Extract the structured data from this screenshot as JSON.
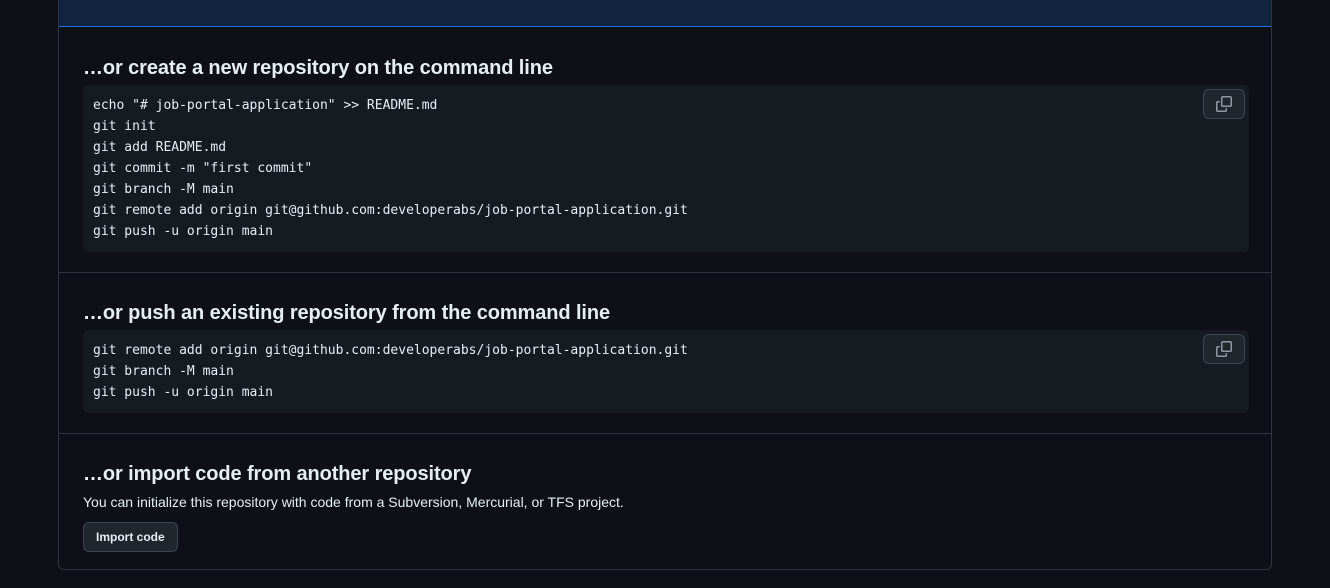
{
  "sections": {
    "create": {
      "title": "…or create a new repository on the command line",
      "lines": [
        "echo \"# job-portal-application\" >> README.md",
        "git init",
        "git add README.md",
        "git commit -m \"first commit\"",
        "git branch -M main",
        "git remote add origin git@github.com:developerabs/job-portal-application.git",
        "git push -u origin main"
      ],
      "copy_icon": "copy-icon"
    },
    "push": {
      "title": "…or push an existing repository from the command line",
      "lines": [
        "git remote add origin git@github.com:developerabs/job-portal-application.git",
        "git branch -M main",
        "git push -u origin main"
      ],
      "copy_icon": "copy-icon"
    },
    "import": {
      "title": "…or import code from another repository",
      "description": "You can initialize this repository with code from a Subversion, Mercurial, or TFS project.",
      "button_label": "Import code"
    }
  },
  "colors": {
    "background": "#0d1117",
    "border": "#30363d",
    "code_bg": "#161b22",
    "accent_border": "#1f6feb"
  }
}
